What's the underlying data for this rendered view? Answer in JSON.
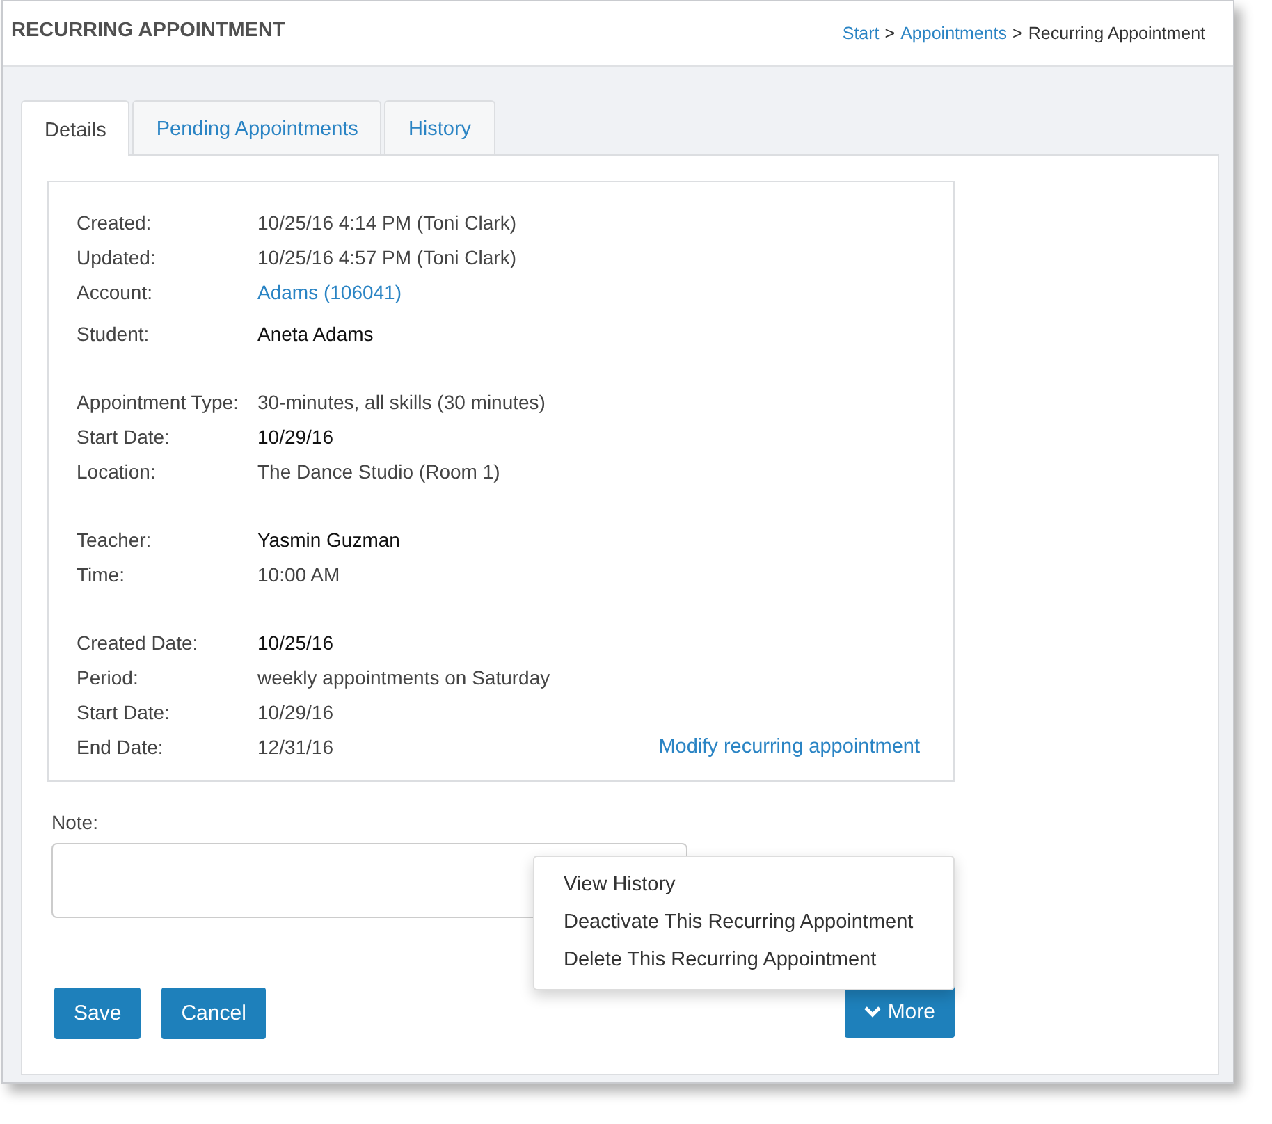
{
  "header": {
    "title": "RECURRING APPOINTMENT",
    "breadcrumb": [
      {
        "label": "Start",
        "kind": "link"
      },
      {
        "label": "Appointments",
        "kind": "link"
      },
      {
        "label": "Recurring Appointment",
        "kind": "current"
      }
    ],
    "separator": ">"
  },
  "tabs": [
    {
      "label": "Details",
      "selected": true
    },
    {
      "label": "Pending Appointments",
      "selected": false
    },
    {
      "label": "History",
      "selected": false
    }
  ],
  "details": {
    "groups": [
      {
        "fields": [
          {
            "label": "Created:",
            "value": "10/25/16 4:14 PM (Toni Clark)",
            "kind": "text"
          },
          {
            "label": "Updated:",
            "value": "10/25/16 4:57 PM (Toni Clark)",
            "kind": "text"
          },
          {
            "label": "Account:",
            "value": "Adams (106041)",
            "kind": "link"
          },
          {
            "label": "Student:",
            "value": "Aneta Adams",
            "kind": "strong"
          }
        ]
      },
      {
        "fields": [
          {
            "label": "Appointment Type:",
            "value": "30-minutes, all skills (30 minutes)",
            "kind": "text"
          },
          {
            "label": "Start Date:",
            "value": "10/29/16",
            "kind": "strong"
          },
          {
            "label": "Location:",
            "value": "The Dance Studio (Room 1)",
            "kind": "text"
          }
        ]
      },
      {
        "fields": [
          {
            "label": "Teacher:",
            "value": "Yasmin Guzman",
            "kind": "strong"
          },
          {
            "label": "Time:",
            "value": "10:00 AM",
            "kind": "text"
          }
        ]
      },
      {
        "fields": [
          {
            "label": "Created Date:",
            "value": "10/25/16",
            "kind": "strong"
          },
          {
            "label": "Period:",
            "value": "weekly appointments on Saturday",
            "kind": "text"
          },
          {
            "label": "Start Date:",
            "value": "10/29/16",
            "kind": "text"
          },
          {
            "label": "End Date:",
            "value": "12/31/16",
            "kind": "text"
          }
        ]
      }
    ],
    "modify_link": "Modify recurring appointment"
  },
  "note": {
    "label": "Note:"
  },
  "buttons": [
    {
      "label": "Save"
    },
    {
      "label": "Cancel"
    }
  ],
  "more_button": {
    "label": "More",
    "expanded": true
  },
  "more_menu": [
    "View History",
    "Deactivate This Recurring Appointment",
    "Delete This Recurring Appointment"
  ]
}
